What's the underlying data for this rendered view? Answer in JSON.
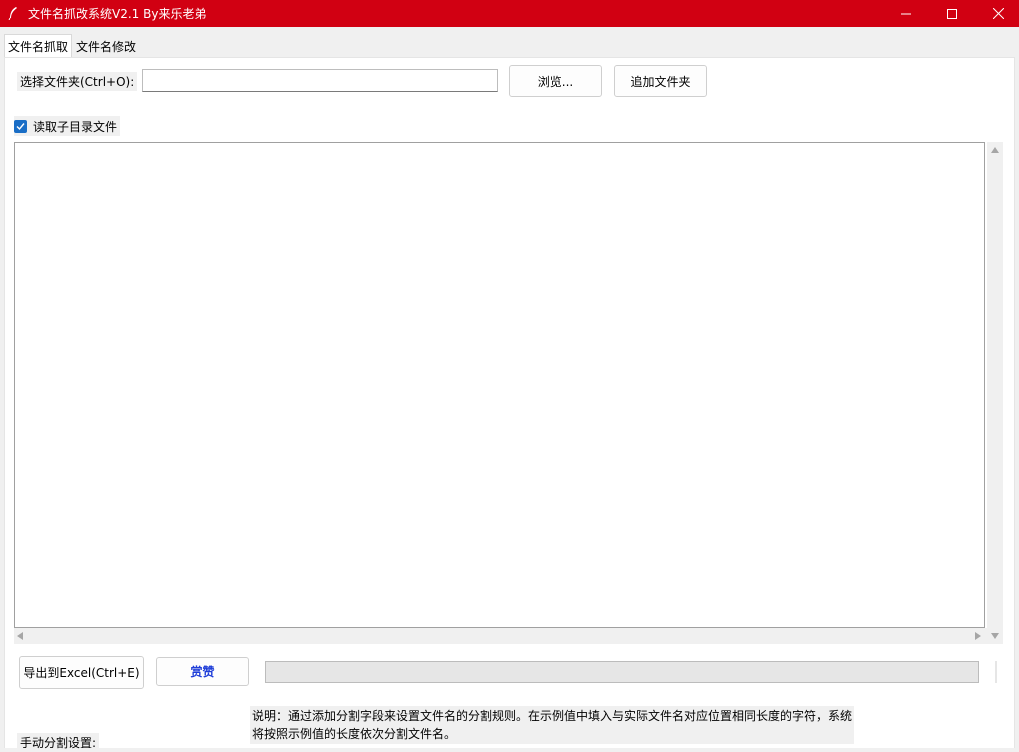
{
  "window": {
    "title": "文件名抓改系统V2.1 By来乐老弟",
    "icon": "feather-pen-icon",
    "title_bar_color": "#d10012"
  },
  "tabs": [
    {
      "label": "文件名抓取",
      "active": true
    },
    {
      "label": "文件名修改",
      "active": false
    }
  ],
  "folder_select": {
    "label": "选择文件夹(Ctrl+O):",
    "value": "",
    "browse_label": "浏览...",
    "add_folder_label": "追加文件夹"
  },
  "subdir_checkbox": {
    "label": "读取子目录文件",
    "checked": true
  },
  "file_list": {
    "items": []
  },
  "actions": {
    "export_label": "导出到Excel(Ctrl+E)",
    "praise_label": "赏赞"
  },
  "progress": {
    "value": 0
  },
  "manual_split": {
    "label": "手动分割设置:",
    "description": "说明：通过添加分割字段来设置文件名的分割规则。在示例值中填入与实际文件名对应位置相同长度的字符，系统将按照示例值的长度依次分割文件名。"
  }
}
